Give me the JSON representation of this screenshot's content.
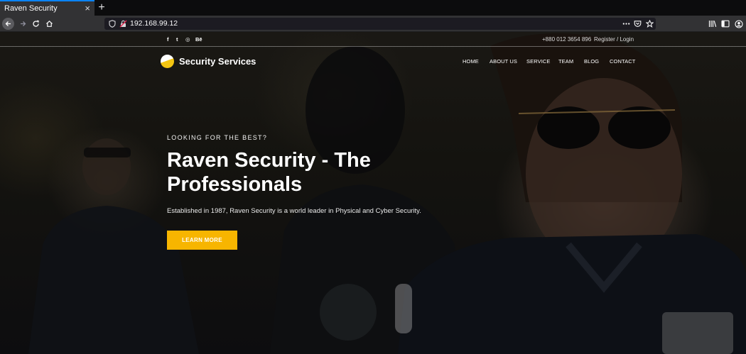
{
  "browser": {
    "tab_title": "Raven Security",
    "tab_close": "×",
    "new_tab": "+",
    "url": "192.168.99.12",
    "accent": "#0a84ff",
    "icons": [
      "back-icon",
      "forward-icon",
      "reload-icon",
      "home-icon",
      "shield-icon",
      "lock-warning-icon",
      "more-icon",
      "pocket-icon",
      "bookmark-star-icon",
      "library-icon",
      "sidebar-icon",
      "account-icon"
    ]
  },
  "site": {
    "topbar": {
      "social": [
        "f",
        "t",
        "◎",
        "Bē"
      ],
      "phone": "+880 012 3654 896",
      "register_login": "Register / Login"
    },
    "brand": {
      "name": "Security Services",
      "logo_colors": [
        "#ffffff",
        "#f4c511"
      ]
    },
    "menu": [
      "HOME",
      "ABOUT US",
      "SERVICE",
      "TEAM",
      "BLOG",
      "CONTACT"
    ],
    "hero": {
      "eyebrow": "LOOKING FOR THE BEST?",
      "headline": "Raven Security - The Professionals",
      "subtext": "Established in 1987, Raven Security is a world leader in Physical and Cyber Security.",
      "cta": "LEARN MORE",
      "cta_color": "#f7b500"
    }
  }
}
